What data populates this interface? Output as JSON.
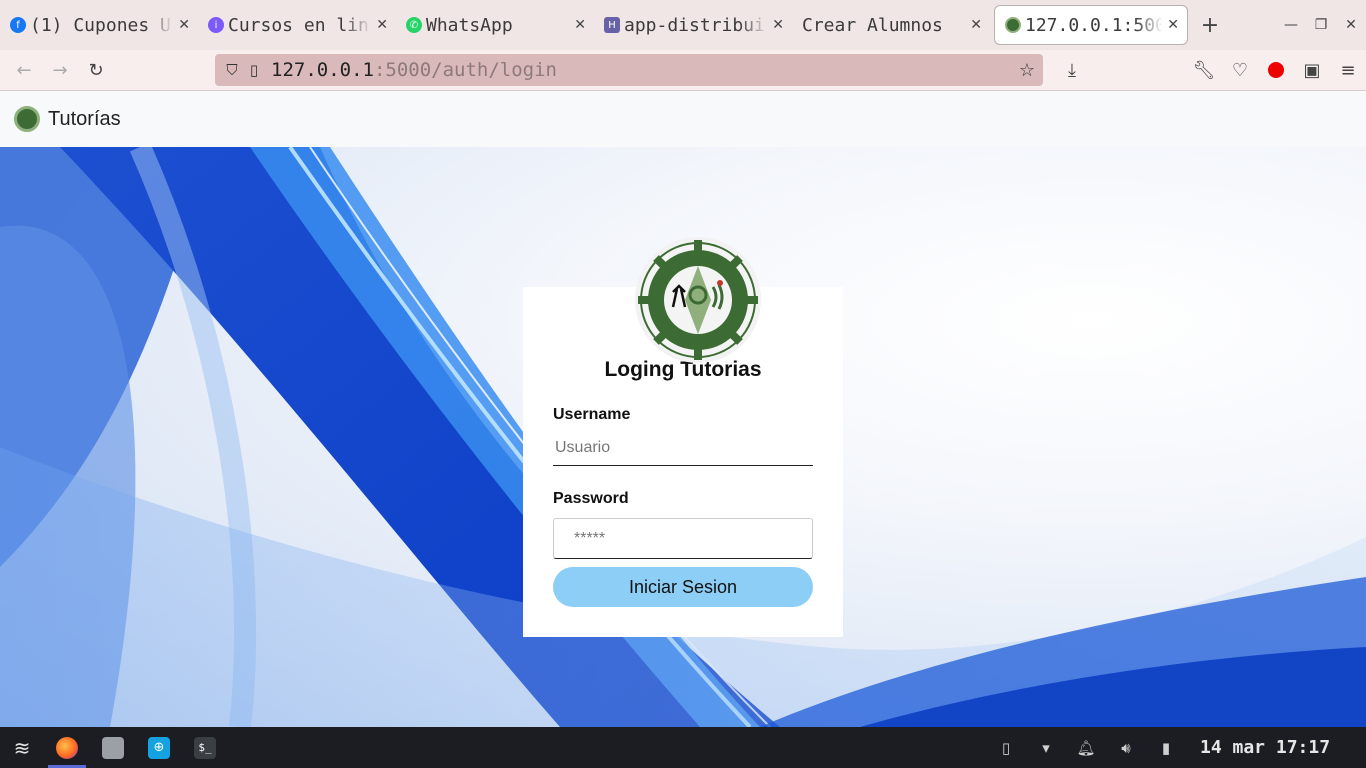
{
  "browser": {
    "tabs": [
      {
        "title": "(1) Cupones U",
        "favicon": "facebook-icon",
        "color": "#1877f2",
        "glyph": "f"
      },
      {
        "title": "Cursos en lin",
        "favicon": "course-site-icon",
        "color": "#7a5af8",
        "glyph": "i"
      },
      {
        "title": "WhatsApp",
        "favicon": "whatsapp-icon",
        "color": "#25d366",
        "glyph": "✆"
      },
      {
        "title": "app-distribui",
        "favicon": "heroku-icon",
        "color": "#6762a6",
        "glyph": "H"
      },
      {
        "title": "Crear Alumnos",
        "favicon": "",
        "color": "",
        "glyph": ""
      },
      {
        "title": "127.0.0.1:500",
        "favicon": "tutorias-seal-icon",
        "color": "#3d6b34",
        "glyph": ""
      }
    ],
    "url_host": "127.0.0.1",
    "url_path": ":5000/auth/login",
    "new_tab_label": "+"
  },
  "header": {
    "brand": "Tutorías"
  },
  "login": {
    "title": "Loging Tutorias",
    "username_label": "Username",
    "username_placeholder": "Usuario",
    "password_label": "Password",
    "password_placeholder": "*****",
    "submit_label": "Iniciar Sesion",
    "seal_colors": {
      "ring": "#3d6b34",
      "inner": "#8fb07c"
    }
  },
  "taskbar": {
    "apps": [
      "zorin-menu-icon",
      "firefox-icon",
      "files-icon",
      "software-store-icon",
      "terminal-icon"
    ],
    "clock": "14 mar 17:17"
  },
  "colors": {
    "accent_button": "#8dcef7",
    "tabstrip": "#f1e6e6",
    "urlbar": "#d9b9b9",
    "taskbar": "#1b1d22"
  }
}
